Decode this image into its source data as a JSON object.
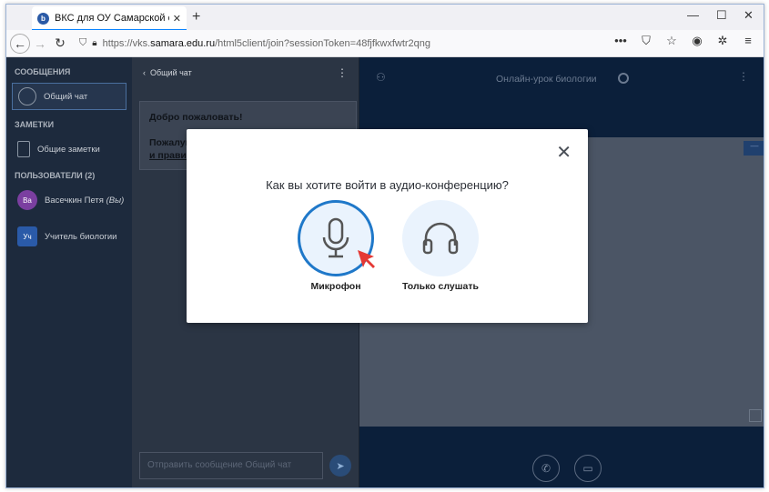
{
  "browser": {
    "tab_title": "ВКС для ОУ Самарской облас",
    "tab_favicon": "b",
    "url_prefix": "https://vks.",
    "url_domain": "samara.edu.ru",
    "url_path": "/html5client/join?sessionToken=48fjfkwxfwtr2qng",
    "accent": "#0a84ff"
  },
  "sidebar": {
    "messages_header": "СООБЩЕНИЯ",
    "public_chat": "Общий чат",
    "notes_header": "ЗАМЕТКИ",
    "shared_notes": "Общие заметки",
    "users_header": "ПОЛЬЗОВАТЕЛИ (2)",
    "users": [
      {
        "initials": "Ва",
        "name": "Васечкин Петя",
        "suffix": "(Вы)",
        "color": "#7b3fa0"
      },
      {
        "initials": "Уч",
        "name": "Учитель биологии",
        "suffix": "",
        "color": "#2a5aa8"
      }
    ]
  },
  "chat": {
    "header": "Общий чат",
    "welcome_title": "Добро пожаловать!",
    "welcome_text_1": "Пожалуйста, соблюдайте ",
    "welcome_link": "общие условия и правила",
    "welcome_text_2": ".",
    "input_placeholder": "Отправить сообщение Общий чат"
  },
  "main": {
    "title": "Онлайн-урок биологии"
  },
  "modal": {
    "question": "Как вы хотите войти в аудио-конференцию?",
    "mic_label": "Микрофон",
    "listen_label": "Только слушать",
    "highlight_color": "#1f78c9"
  }
}
